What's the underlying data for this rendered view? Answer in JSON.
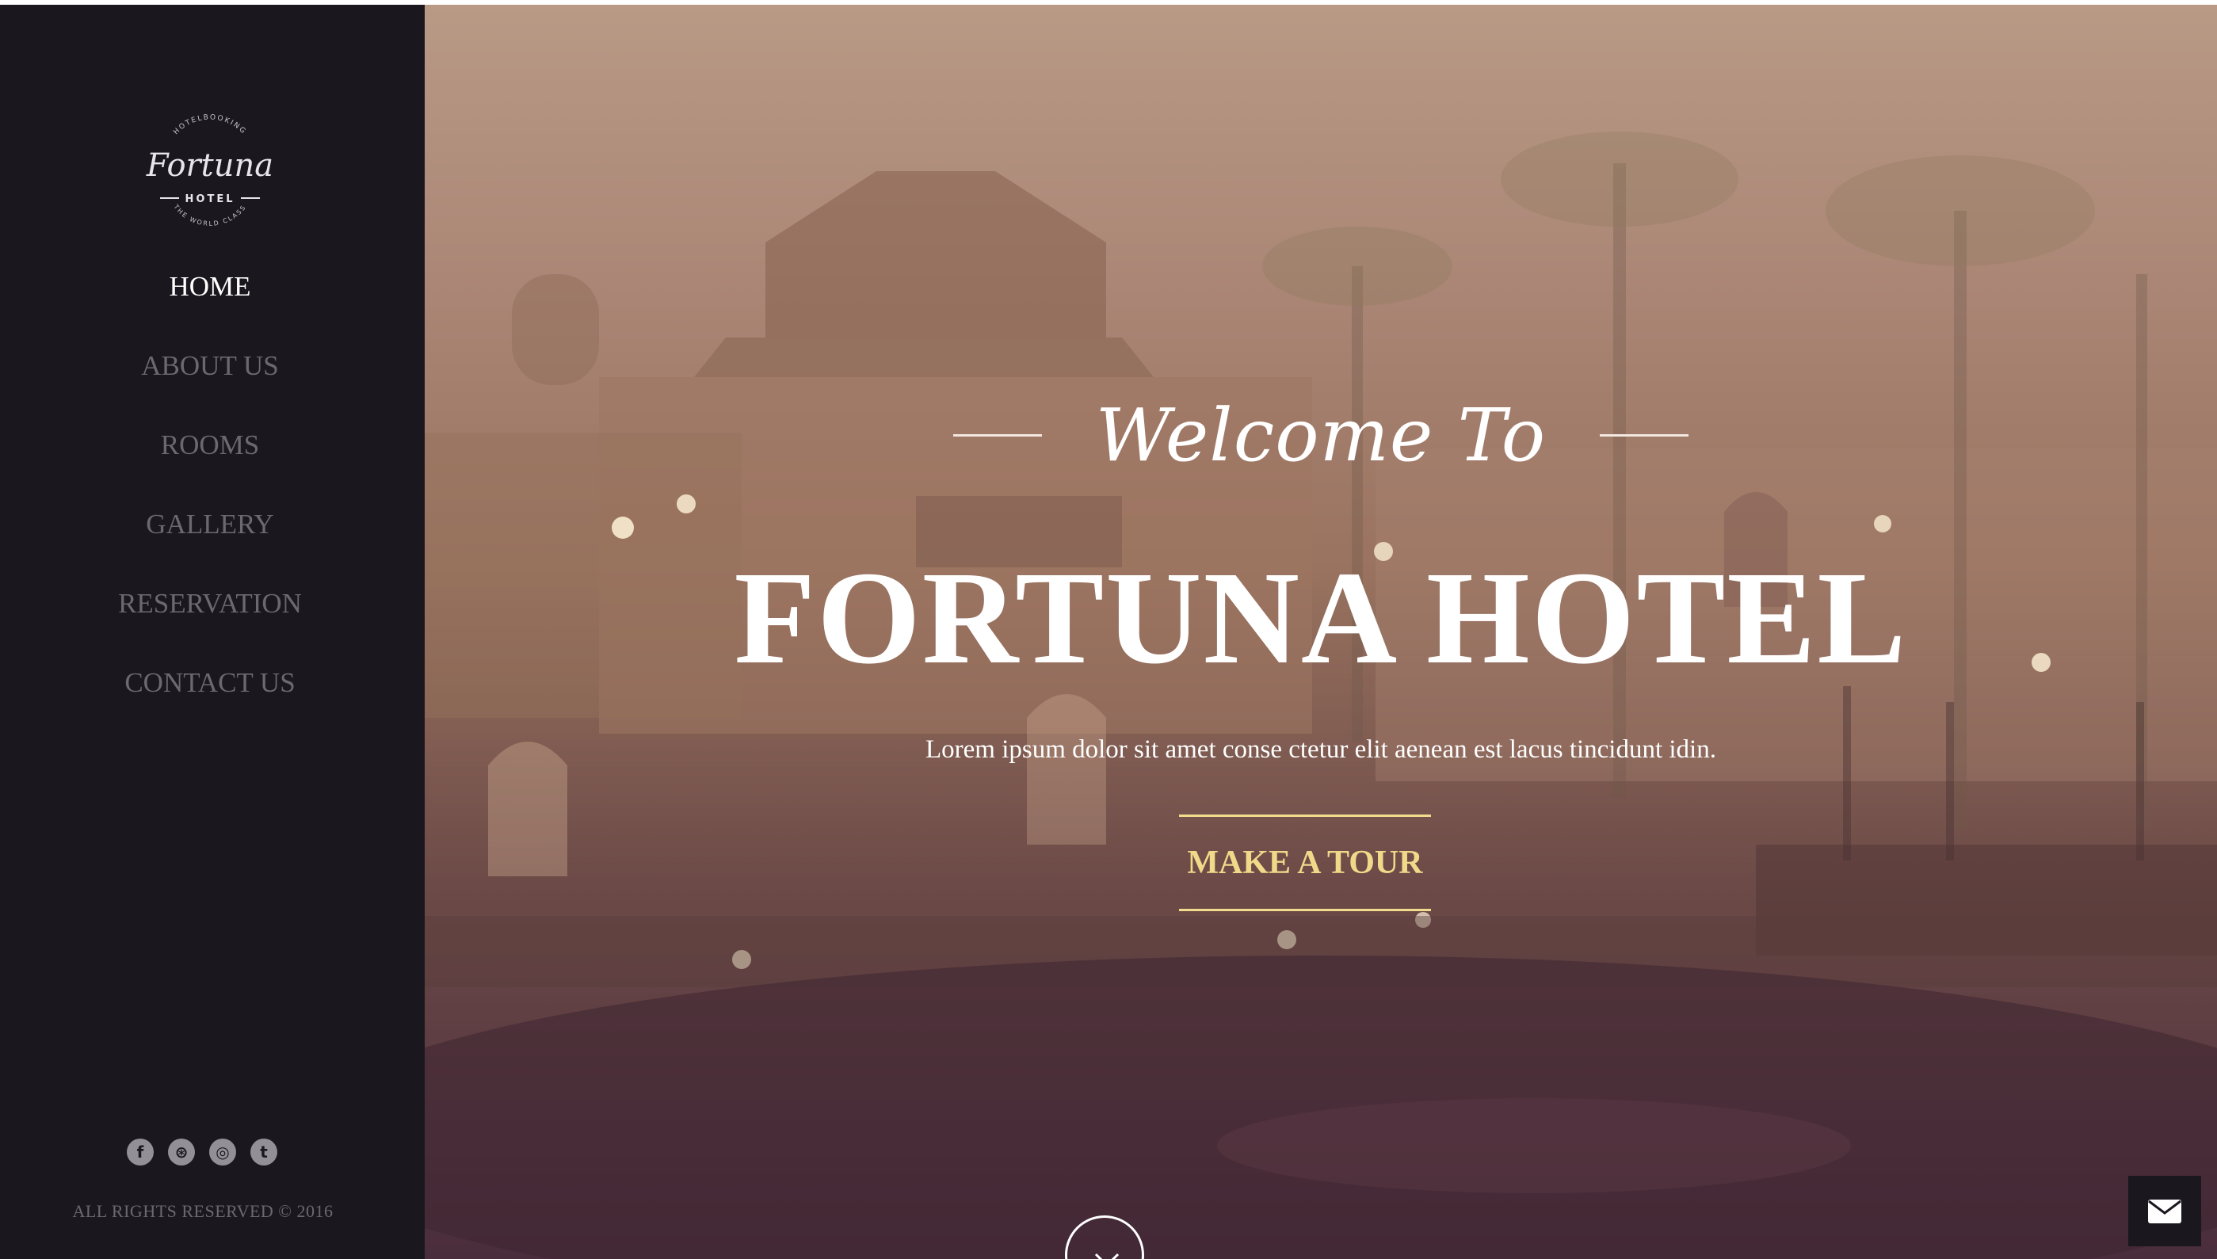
{
  "logo": {
    "script_text": "Fortuna",
    "top_arc_text": "HOTELBOOKING",
    "badge_text": "HOTEL",
    "bottom_arc_text": "THE WORLD CLASS"
  },
  "nav": {
    "items": [
      {
        "label": "HOME",
        "active": true
      },
      {
        "label": "ABOUT US",
        "active": false
      },
      {
        "label": "ROOMS",
        "active": false
      },
      {
        "label": "GALLERY",
        "active": false
      },
      {
        "label": "RESERVATION",
        "active": false
      },
      {
        "label": "CONTACT US",
        "active": false
      }
    ]
  },
  "social": {
    "icons": [
      "facebook-icon",
      "dribbble-icon",
      "instagram-icon",
      "twitter-icon"
    ],
    "glyphs": [
      "f",
      "⊛",
      "◎",
      "t"
    ]
  },
  "footer": {
    "copyright": "ALL RIGHTS RESERVED © 2016"
  },
  "hero": {
    "welcome": "Welcome To",
    "title": "FORTUNA HOTEL",
    "subtitle": "Lorem ipsum dolor sit amet conse ctetur elit aenean est lacus tincidunt idin.",
    "cta_label": "MAKE A TOUR"
  },
  "colors": {
    "sidebar_bg": "#1b171e",
    "nav_active": "#ffffff",
    "nav_inactive": "#6d6870",
    "accent_gold": "#f1d98a"
  },
  "icons": {
    "scroll": "chevron-down-icon",
    "mail": "envelope-icon"
  }
}
